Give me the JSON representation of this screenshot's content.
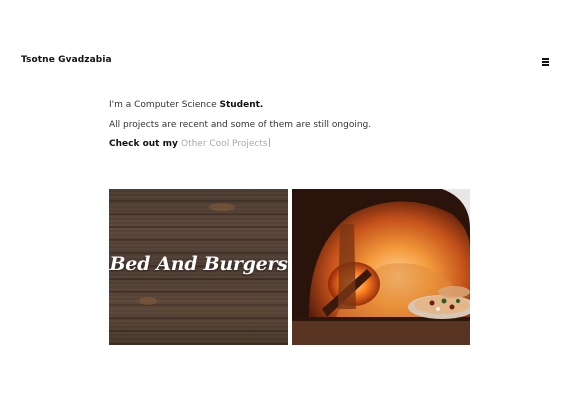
{
  "header": {
    "brand": "Tsotne Gvadzabia",
    "menu_icon": "hamburger-menu-icon"
  },
  "intro": {
    "line1_text": "I'm a Computer Science ",
    "line1_bold": "Student.",
    "line2": "All projects are recent and some of them are still ongoing.",
    "line3_prefix": "Check out my ",
    "line3_link": "Other Cool Projects"
  },
  "projects": [
    {
      "title": "Bed And Burgers"
    },
    {
      "title": ""
    }
  ]
}
